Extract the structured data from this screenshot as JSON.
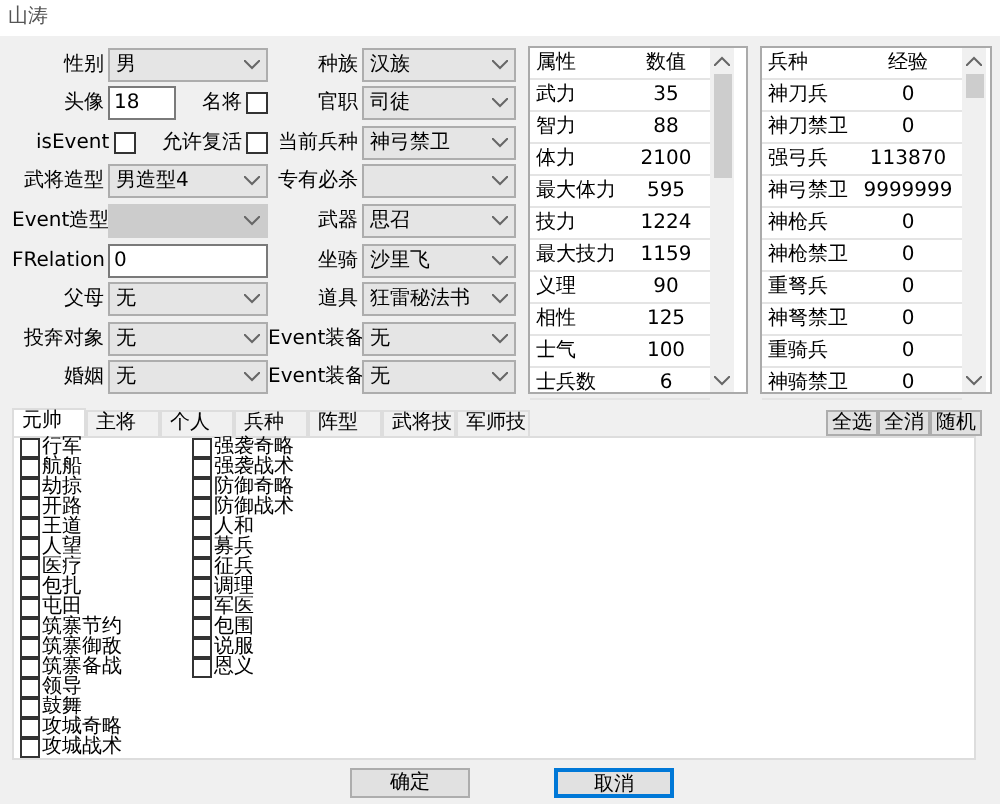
{
  "window": {
    "title": "山涛"
  },
  "left_rows": [
    {
      "items": [
        {
          "kind": "select",
          "label": "性别",
          "value": "男",
          "disabled": false
        }
      ]
    },
    {
      "items": [
        {
          "kind": "text",
          "label": "头像",
          "value": "18"
        },
        {
          "kind": "checkbox",
          "label": "名将",
          "checked": false
        }
      ]
    },
    {
      "items": [
        {
          "kind": "checkbox",
          "label": "isEvent",
          "checked": false
        },
        {
          "kind": "checkbox",
          "label": "允许复活",
          "checked": false
        }
      ]
    },
    {
      "items": [
        {
          "kind": "select",
          "label": "武将造型",
          "value": "男造型4",
          "disabled": false
        }
      ]
    },
    {
      "items": [
        {
          "kind": "select",
          "label": "Event造型",
          "disabled": true
        }
      ]
    },
    {
      "items": [
        {
          "kind": "text",
          "label": "FRelation",
          "value": "0"
        }
      ]
    },
    {
      "items": [
        {
          "kind": "select",
          "label": "父母",
          "value": "无",
          "disabled": false
        }
      ]
    },
    {
      "items": [
        {
          "kind": "select",
          "label": "投奔对象",
          "value": "无",
          "disabled": false
        }
      ]
    },
    {
      "items": [
        {
          "kind": "select",
          "label": "婚姻",
          "value": "无",
          "disabled": false
        }
      ]
    }
  ],
  "right_fields": [
    {
      "label": "种族",
      "value": "汉族",
      "disabled": false
    },
    {
      "label": "官职",
      "value": "司徒",
      "disabled": false
    },
    {
      "label": "当前兵种",
      "value": "神弓禁卫",
      "disabled": false
    },
    {
      "label": "专有必杀",
      "disabled": false
    },
    {
      "label": "武器",
      "value": "思召",
      "disabled": false
    },
    {
      "label": "坐骑",
      "value": "沙里飞",
      "disabled": false
    },
    {
      "label": "道具",
      "value": "狂雷秘法书",
      "disabled": false
    },
    {
      "label": "Event装备",
      "value": "无",
      "disabled": false
    },
    {
      "label": "Event装备",
      "value": "无",
      "disabled": false
    }
  ],
  "attribute_table": {
    "columns": [
      "属性",
      "数值"
    ],
    "rows": [
      [
        "武力",
        "35"
      ],
      [
        "智力",
        "88"
      ],
      [
        "体力",
        "2100"
      ],
      [
        "最大体力",
        "595"
      ],
      [
        "技力",
        "1224"
      ],
      [
        "最大技力",
        "1159"
      ],
      [
        "义理",
        "90"
      ],
      [
        "相性",
        "125"
      ],
      [
        "士气",
        "100"
      ],
      [
        "士兵数",
        "6"
      ]
    ]
  },
  "troop_table": {
    "columns": [
      "兵种",
      "经验"
    ],
    "rows": [
      [
        "神刀兵",
        "0"
      ],
      [
        "神刀禁卫",
        "0"
      ],
      [
        "强弓兵",
        "113870"
      ],
      [
        "神弓禁卫",
        "9999999"
      ],
      [
        "神枪兵",
        "0"
      ],
      [
        "神枪禁卫",
        "0"
      ],
      [
        "重弩兵",
        "0"
      ],
      [
        "神弩禁卫",
        "0"
      ],
      [
        "重骑兵",
        "0"
      ],
      [
        "神骑禁卫",
        "0"
      ]
    ]
  },
  "tabs": [
    {
      "label": "元帅",
      "selected": true
    },
    {
      "label": "主将",
      "selected": false
    },
    {
      "label": "个人",
      "selected": false
    },
    {
      "label": "兵种",
      "selected": false
    },
    {
      "label": "阵型",
      "selected": false
    },
    {
      "label": "武将技",
      "selected": false
    },
    {
      "label": "军师技",
      "selected": false
    }
  ],
  "tab_actions": [
    "全选",
    "全消",
    "随机"
  ],
  "skill_columns": [
    [
      {
        "label": "行军",
        "checked": false
      },
      {
        "label": "航船",
        "checked": false
      },
      {
        "label": "劫掠",
        "checked": false
      },
      {
        "label": "开路",
        "checked": false
      },
      {
        "label": "王道",
        "checked": false
      },
      {
        "label": "人望",
        "checked": false
      },
      {
        "label": "医疗",
        "checked": false
      },
      {
        "label": "包扎",
        "checked": false
      },
      {
        "label": "屯田",
        "checked": false
      },
      {
        "label": "筑寨节约",
        "checked": false
      },
      {
        "label": "筑寨御敌",
        "checked": false
      },
      {
        "label": "筑寨备战",
        "checked": false
      },
      {
        "label": "领导",
        "checked": false
      },
      {
        "label": "鼓舞",
        "checked": false
      },
      {
        "label": "攻城奇略",
        "checked": false
      },
      {
        "label": "攻城战术",
        "checked": false
      }
    ],
    [
      {
        "label": "强袭奇略",
        "checked": false
      },
      {
        "label": "强袭战术",
        "checked": false
      },
      {
        "label": "防御奇略",
        "checked": false
      },
      {
        "label": "防御战术",
        "checked": false
      },
      {
        "label": "人和",
        "checked": false
      },
      {
        "label": "募兵",
        "checked": false
      },
      {
        "label": "征兵",
        "checked": false
      },
      {
        "label": "调理",
        "checked": false
      },
      {
        "label": "军医",
        "checked": false
      },
      {
        "label": "包围",
        "checked": false
      },
      {
        "label": "说服",
        "checked": false
      },
      {
        "label": "恩义",
        "checked": false
      }
    ]
  ],
  "buttons": [
    {
      "label": "确定",
      "focused": false
    },
    {
      "label": "取消",
      "focused": true
    }
  ]
}
